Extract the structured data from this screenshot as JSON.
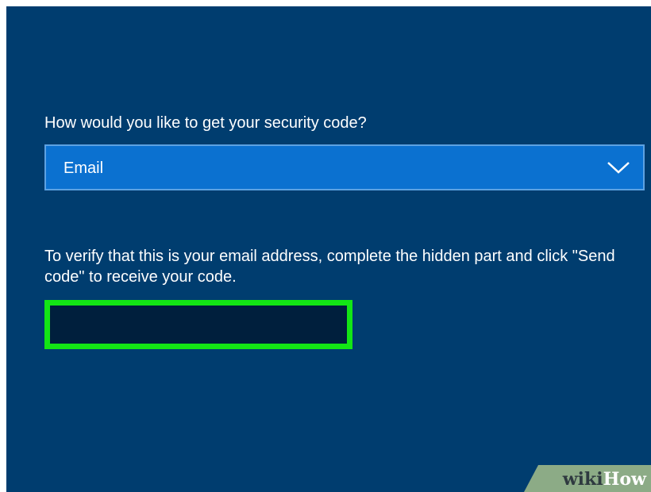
{
  "prompt": {
    "question": "How would you like to get your security code?"
  },
  "method_select": {
    "selected": "Email",
    "icon": "chevron-down-icon"
  },
  "verify": {
    "instructions": "To verify that this is your email address, complete the hidden part and click \"Send code\" to receive your code."
  },
  "email_input": {
    "value": ""
  },
  "watermark": {
    "part1": "wiki",
    "part2": "How"
  },
  "colors": {
    "background": "#003d6f",
    "select_fill": "#0b71d0",
    "input_fill": "#001f3d",
    "highlight": "#13e515",
    "watermark_band": "#8cab86"
  }
}
